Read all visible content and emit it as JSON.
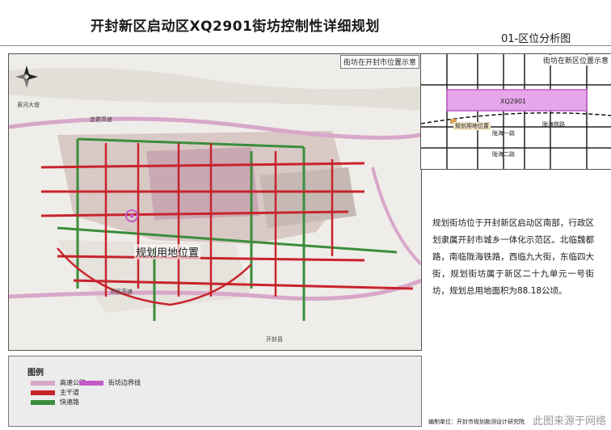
{
  "header": {
    "title": "开封新区启动区XQ2901街坊控制性详细规划",
    "subtitle": "01-区位分析图"
  },
  "main_map": {
    "frame_label": "街坊在开封市位置示意",
    "site_label": "规划用地位置",
    "road_labels": [
      "黄河大堤",
      "连霍高速",
      "郑民高速",
      "开封县"
    ],
    "accent_colors": {
      "expressway": "#d8a7c9",
      "main_road": "#c8242c",
      "fast_road": "#3b8d3b",
      "boundary": "#c25ac8"
    }
  },
  "inset_map": {
    "label": "街坊在新区位置示意",
    "block_label": "XQ2901",
    "site_label": "规划用地位置",
    "road_labels": [
      "陇海铁路",
      "陇海一路",
      "陇海二路"
    ]
  },
  "description": "规划街坊位于开封新区启动区南部，行政区划隶属开封市城乡一体化示范区。北临魏都路，南临陇海铁路，西临九大街，东临四大街，规划街坊属于新区二十九单元一号街坊，规划总用地面积为88.18公顷。",
  "legend": {
    "title": "图例",
    "items": [
      {
        "label": "高速公路",
        "color": "#d8a7c9"
      },
      {
        "label": "主干道",
        "color": "#c8242c"
      },
      {
        "label": "快速路",
        "color": "#3b8d3b"
      },
      {
        "label": "街坊边界线",
        "color": "#c25ac8"
      }
    ]
  },
  "credit": "编制单位：开封市规划勘测设计研究院",
  "watermark": "此图来源于网络"
}
